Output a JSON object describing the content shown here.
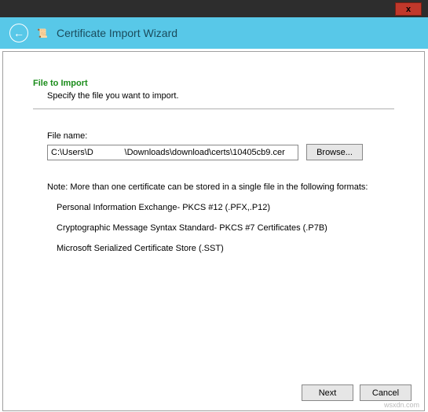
{
  "window": {
    "close_x": "x"
  },
  "header": {
    "title": "Certificate Import Wizard",
    "back_arrow": "←",
    "wizard_icon": "📜"
  },
  "content": {
    "section_title": "File to Import",
    "section_sub": "Specify the file you want to import.",
    "file_label": "File name:",
    "file_value": "C:\\Users\\D             \\Downloads\\download\\certs\\10405cb9.cer",
    "browse_label": "Browse...",
    "note": "Note:  More than one certificate can be stored in a single file in the following formats:",
    "formats": [
      "Personal Information Exchange- PKCS #12 (.PFX,.P12)",
      "Cryptographic Message Syntax Standard- PKCS #7 Certificates (.P7B)",
      "Microsoft Serialized Certificate Store (.SST)"
    ]
  },
  "buttons": {
    "next": "Next",
    "cancel": "Cancel"
  },
  "watermark": "wsxdn.com"
}
